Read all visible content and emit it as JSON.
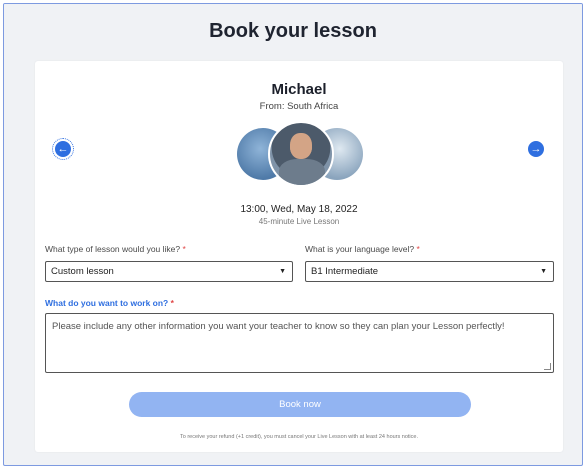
{
  "header": {
    "title": "Book your lesson"
  },
  "teacher": {
    "name": "Michael",
    "from": "From: South Africa"
  },
  "carousel": {
    "prev_icon": "arrow-left-circle",
    "next_icon": "arrow-right-circle"
  },
  "slot": {
    "datetime": "13:00, Wed, May 18, 2022",
    "duration": "45-minute Live Lesson"
  },
  "lesson_type": {
    "label": "What type of lesson would you like?",
    "value": "Custom lesson"
  },
  "level": {
    "label": "What is your language level?",
    "value": "B1 Intermediate"
  },
  "focus": {
    "label": "What do you want to work on?",
    "placeholder": "Please include any other information you want your teacher to know so they can plan your Lesson perfectly!"
  },
  "book_button": {
    "label": "Book now"
  },
  "refund_note": "To receive your refund (+1 credit), you must cancel your Live Lesson with at least 24 hours notice.",
  "colors": {
    "accent": "#2f6fe0",
    "button_disabled": "#92b4f2",
    "required": "#e04545"
  }
}
